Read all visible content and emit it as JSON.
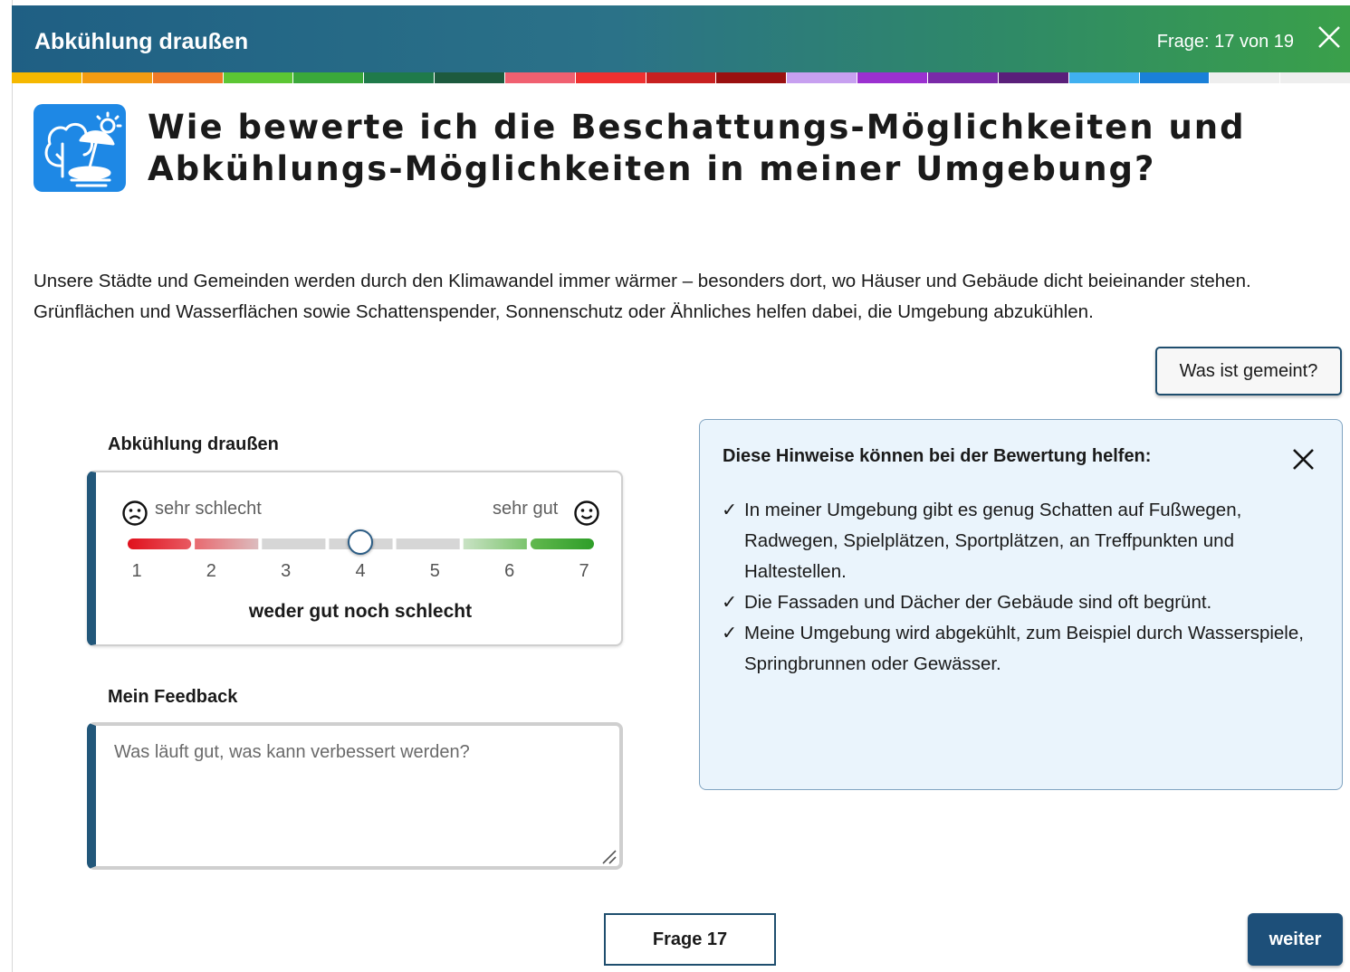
{
  "header": {
    "title": "Abkühlung draußen",
    "counter": "Frage: 17 von 19",
    "close_icon": "close-icon"
  },
  "progress_colors": [
    "#f5b800",
    "#f39c12",
    "#f07a28",
    "#5cc634",
    "#3aa83a",
    "#1f7a4a",
    "#1d5a3e",
    "#f06070",
    "#ee3030",
    "#c72020",
    "#9a1010",
    "#c7a0f0",
    "#9b30d0",
    "#7a2aa8",
    "#5a1f7a",
    "#40b0f0",
    "#1a80d8",
    "#eeeeee",
    "#eeeeee"
  ],
  "question": {
    "icon": "shade-tree-umbrella-icon",
    "title": "Wie bewerte ich die Beschattungs-Möglichkeiten und Abkühlungs-Möglichkeiten in meiner Umgebung?",
    "intro": "Unsere Städte und Gemeinden werden durch den Klimawandel immer wärmer – besonders dort, wo Häuser und Gebäude dicht beieinander stehen. Grünflächen und Wasserflächen sowie Schattenspender, Sonnenschutz oder Ähnliches helfen dabei, die Umgebung abzukühlen."
  },
  "help_button": "Was ist gemeint?",
  "rating": {
    "label": "Abkühlung draußen",
    "low_label": "sehr schlecht",
    "high_label": "sehr gut",
    "ticks": [
      "1",
      "2",
      "3",
      "4",
      "5",
      "6",
      "7"
    ],
    "value": 4,
    "value_label": "weder gut noch schlecht",
    "segment_colors": [
      [
        "#e0101c",
        "#e85a62"
      ],
      [
        "#e86a70",
        "#dcbcbe"
      ],
      [
        "#d6d6d6",
        "#d6d6d6"
      ],
      [
        "#d6d6d6",
        "#d6d6d6"
      ],
      [
        "#d6d6d6",
        "#d6d6d6"
      ],
      [
        "#c9e2c4",
        "#7cc46e"
      ],
      [
        "#62b84f",
        "#2e9e28"
      ]
    ]
  },
  "feedback": {
    "label": "Mein Feedback",
    "placeholder": "Was läuft gut, was kann verbessert werden?"
  },
  "hints": {
    "title": "Diese Hinweise können bei der Bewertung helfen:",
    "check_symbol": "✓",
    "items": [
      "In meiner Umgebung gibt es genug Schatten auf Fußwegen, Radwegen, Spielplätzen, Sportplätzen, an Treffpunkten und Haltestellen.",
      "Die Fassaden und Dächer der Gebäude sind oft begrünt.",
      "Meine Umgebung wird abgekühlt, zum Beispiel durch Wasserspiele, Springbrunnen oder Gewässer."
    ]
  },
  "footer": {
    "question_button": "Frage 17",
    "next_button": "weiter"
  }
}
